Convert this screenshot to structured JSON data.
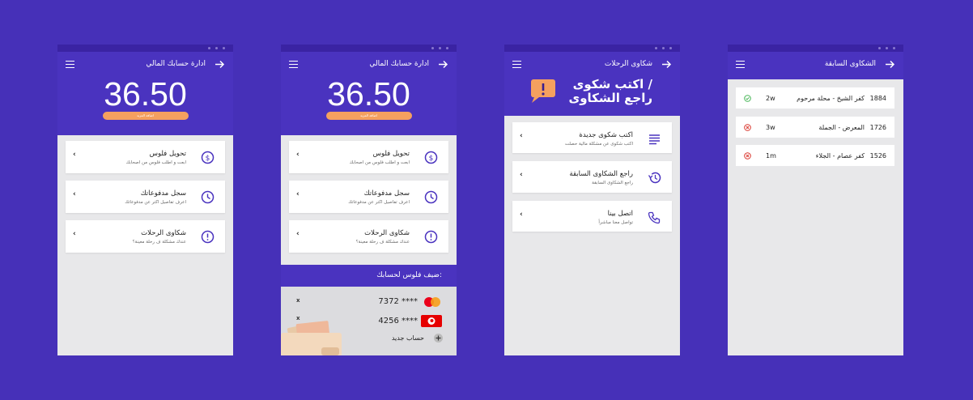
{
  "colors": {
    "background": "#4630b8",
    "header": "#4a33bf",
    "accent": "#f5a05f",
    "icon": "#4a33bf",
    "ok": "#46b556",
    "error": "#d9342b"
  },
  "screen1": {
    "title": "ادارة حسابك المالي",
    "balance": "36.50",
    "add_more": "اضافة المزيد",
    "items": [
      {
        "title": "تحويل فلوس",
        "subtitle": "ابعت و اطلب فلوس من اصحابك",
        "icon": "dollar-circle-icon"
      },
      {
        "title": "سجل مدفوعاتك",
        "subtitle": "اعرف تفاصيل اكتر عن مدفوعاتك",
        "icon": "clock-icon"
      },
      {
        "title": "شكاوى الرحلات",
        "subtitle": "عندك مشكلة ف رحلة معينة؟",
        "icon": "alert-circle-icon"
      }
    ]
  },
  "screen2": {
    "title": "ادارة حسابك المالي",
    "balance": "36.50",
    "add_more": "اضافة المزيد",
    "items": [
      {
        "title": "تحويل فلوس",
        "subtitle": "ابعت و اطلب فلوس من اصحابك",
        "icon": "dollar-circle-icon"
      },
      {
        "title": "سجل مدفوعاتك",
        "subtitle": "اعرف تفاصيل اكتر عن مدفوعاتك",
        "icon": "clock-icon"
      },
      {
        "title": "شكاوى الرحلات",
        "subtitle": "عندك مشكلة ف رحلة معينة؟",
        "icon": "alert-circle-icon"
      }
    ],
    "add_money_header": "ضيف فلوس لحسابك:",
    "cards": [
      {
        "number": "7372 ****",
        "brand": "mastercard-icon",
        "remove": "x"
      },
      {
        "number": "4256 ****",
        "brand": "vodafone-icon",
        "remove": "x"
      }
    ],
    "new_account": "حساب جديد"
  },
  "screen3": {
    "title": "شكاوى الرحلات",
    "heading_line1": "اكتب شكوى /",
    "heading_line2": "راجع الشكاوى",
    "items": [
      {
        "title": "اكتب شكوى جديدة",
        "subtitle": "اكتب شكوى عن مشكلة مالية حصلت",
        "icon": "text-lines-icon"
      },
      {
        "title": "راجع الشكاوى السابقة",
        "subtitle": "راجع الشكاوى السابقة",
        "icon": "history-icon"
      },
      {
        "title": "اتصل بينا",
        "subtitle": "تواصل معنا مباشراً",
        "icon": "phone-icon"
      }
    ]
  },
  "screen4": {
    "title": "الشكاوى السابقة",
    "complaints": [
      {
        "id": "1884",
        "name": "كفر الشيخ - محلة مرحوم",
        "age": "2w",
        "status": "resolved"
      },
      {
        "id": "1726",
        "name": "المعرض - الجملة",
        "age": "3w",
        "status": "rejected"
      },
      {
        "id": "1526",
        "name": "كفر عصام - الجلاء",
        "age": "1m",
        "status": "rejected"
      }
    ]
  }
}
